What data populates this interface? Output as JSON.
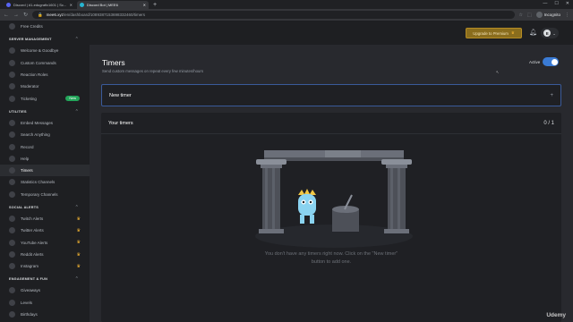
{
  "browser": {
    "tabs": [
      {
        "title": "Discord | #1-edugrafix1601 | Sc...",
        "active": false,
        "color": "#5865f2"
      },
      {
        "title": "Discord Bot | MEE6",
        "active": true,
        "color": "#27b5d1"
      }
    ],
    "new_tab": "+",
    "url_host": "mee6.xyz",
    "url_path": "/en/dashboard/1089387153698332460/timers",
    "profile_label": "Incognito"
  },
  "sidebar": {
    "top_item": "Free Credits",
    "sections": [
      {
        "heading": "SERVER MANAGEMENT",
        "items": [
          {
            "label": "Welcome & Goodbye"
          },
          {
            "label": "Custom Commands"
          },
          {
            "label": "Reaction Roles"
          },
          {
            "label": "Moderator"
          },
          {
            "label": "Ticketing",
            "badge": "New"
          }
        ]
      },
      {
        "heading": "UTILITIES",
        "items": [
          {
            "label": "Embed Messages"
          },
          {
            "label": "Search Anything"
          },
          {
            "label": "Record"
          },
          {
            "label": "Help"
          },
          {
            "label": "Timers",
            "active": true
          },
          {
            "label": "Statistics Channels"
          },
          {
            "label": "Temporary Channels"
          }
        ]
      },
      {
        "heading": "SOCIAL ALERTS",
        "items": [
          {
            "label": "Twitch Alerts",
            "premium": true
          },
          {
            "label": "Twitter Alerts",
            "premium": true
          },
          {
            "label": "YouTube Alerts",
            "premium": true
          },
          {
            "label": "Reddit Alerts",
            "premium": true
          },
          {
            "label": "Instagram",
            "premium": true
          }
        ]
      },
      {
        "heading": "ENGAGEMENT & FUN",
        "items": [
          {
            "label": "Giveaways"
          },
          {
            "label": "Levels"
          },
          {
            "label": "Birthdays"
          }
        ]
      }
    ]
  },
  "topbar": {
    "upgrade_label": "Upgrade to Premium",
    "user_initial": "E"
  },
  "page": {
    "title": "Timers",
    "subtitle": "Send custom messages on repeat every few minutes/hours",
    "active_label": "Active",
    "active_on": true,
    "new_timer_label": "New timer",
    "your_timers_label": "Your timers",
    "timer_count": "0 / 1",
    "empty_line1": "You don't have any timers right now. Click on the \"New timer\"",
    "empty_line2": "button to add one."
  },
  "watermark": "Udemy",
  "colors": {
    "accent": "#3a7bd5",
    "premium": "#f0b232",
    "new_badge": "#23a55a"
  }
}
